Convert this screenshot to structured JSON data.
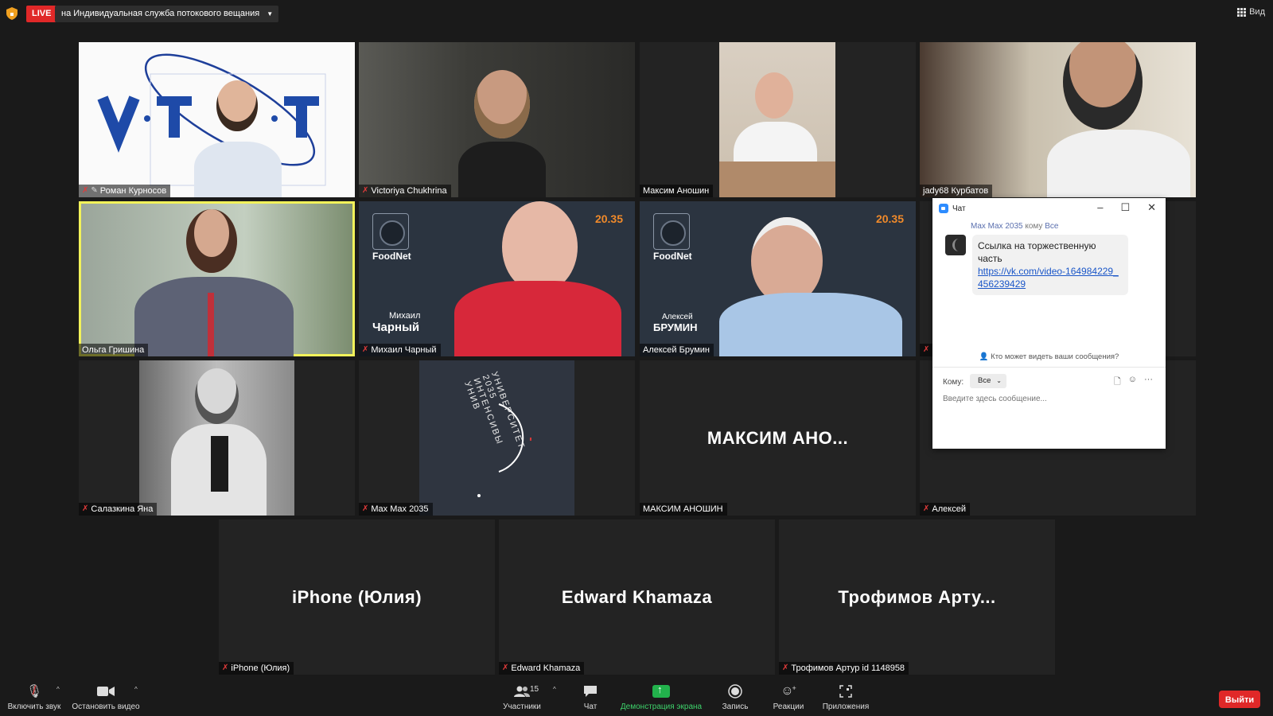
{
  "topbar": {
    "live_label": "LIVE",
    "stream_label": "на Индивидуальная служба потокового вещания",
    "view_label": "Вид"
  },
  "tiles": [
    {
      "name": "Роман Курносов",
      "muted": true,
      "pinned": true
    },
    {
      "name": "Victoriya Chukhrina",
      "muted": true
    },
    {
      "name": "Максим Аношин",
      "muted": false
    },
    {
      "name": "jady68 Курбатов",
      "muted": false
    },
    {
      "name": "Ольга Гришина",
      "muted": false,
      "active_speaker": true
    },
    {
      "name": "Михаил Чарный",
      "muted": true
    },
    {
      "name": "Алексей Брумин",
      "muted": false
    },
    {
      "name": "Салазкина Яна",
      "muted": true
    },
    {
      "name": "Max Max 2035",
      "muted": true
    },
    {
      "name": "МАКСИМ АНОШИН",
      "muted": false,
      "display_text": "МАКСИМ АНО..."
    },
    {
      "name": "Алексей",
      "muted": true
    },
    {
      "name": "iPhone (Юлия)",
      "muted": true,
      "display_text": "iPhone (Юлия)"
    },
    {
      "name": "Edward Khamaza",
      "muted": true,
      "display_text": "Edward Khamaza"
    },
    {
      "name": "Трофимов Артур id 1148958",
      "muted": true,
      "display_text": "Трофимов Арту..."
    }
  ],
  "slides": {
    "foodnet_label": "FoodNet",
    "brand_2035": "20.35",
    "charny_first": "Михаил",
    "charny_last": "Чарный",
    "brumin_first": "Алексей",
    "brumin_last": "БРУМИН",
    "vtt_logo": "V·T·T",
    "university_text": "УНИВЕРСИТЕТ 2035 ИНТЕНСИВЫ УНИВ"
  },
  "chat": {
    "title": "Чат",
    "sender": "Max Max 2035",
    "to_word": "кому",
    "recipient": "Все",
    "message_text": "Ссылка на торжественную часть",
    "message_link": "https://vk.com/video-164984229_456239429",
    "who_can_see": "Кто может видеть ваши сообщения?",
    "to_label": "Кому:",
    "to_value": "Все",
    "input_placeholder": "Введите здесь сообщение..."
  },
  "toolbar": {
    "unmute": "Включить звук",
    "stop_video": "Остановить видео",
    "participants": "Участники",
    "participants_count": "15",
    "chat": "Чат",
    "share_screen": "Демонстрация экрана",
    "record": "Запись",
    "reactions": "Реакции",
    "apps": "Приложения",
    "leave": "Выйти"
  },
  "colors": {
    "active_speaker": "#f2f25a",
    "live": "#e02828",
    "share": "#22b24c",
    "slide_bg": "#2b3440"
  }
}
